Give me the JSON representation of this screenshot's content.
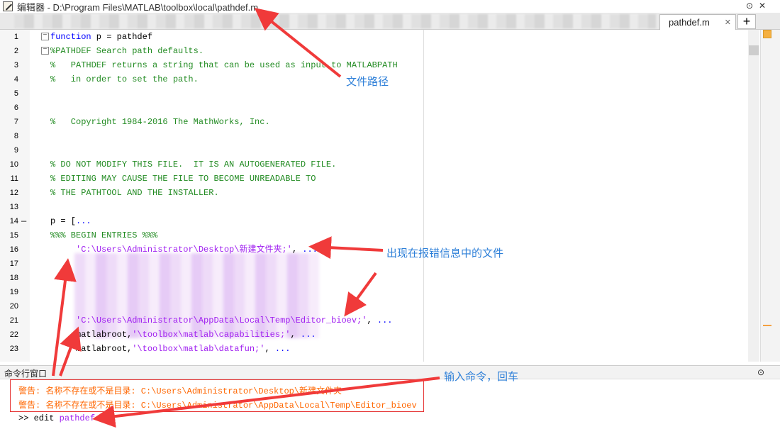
{
  "window": {
    "title": "编辑器 - D:\\Program Files\\MATLAB\\toolbox\\local\\pathdef.m"
  },
  "tabs": {
    "active": "pathdef.m",
    "close": "✕",
    "add": "+"
  },
  "editor": {
    "lines": [
      {
        "n": "1",
        "parts": [
          [
            "k",
            "function"
          ],
          [
            "n",
            " p = pathdef"
          ]
        ]
      },
      {
        "n": "2",
        "parts": [
          [
            "c",
            "%PATHDEF Search path defaults."
          ]
        ]
      },
      {
        "n": "3",
        "parts": [
          [
            "c",
            "%   PATHDEF returns a string that can be used as input to MATLABPATH"
          ]
        ]
      },
      {
        "n": "4",
        "parts": [
          [
            "c",
            "%   in order to set the path."
          ]
        ]
      },
      {
        "n": "5",
        "parts": []
      },
      {
        "n": "6",
        "parts": []
      },
      {
        "n": "7",
        "parts": [
          [
            "c",
            "%   Copyright 1984-2016 The MathWorks, Inc."
          ]
        ]
      },
      {
        "n": "8",
        "parts": []
      },
      {
        "n": "9",
        "parts": []
      },
      {
        "n": "10",
        "parts": [
          [
            "c",
            "% DO NOT MODIFY THIS FILE.  IT IS AN AUTOGENERATED FILE."
          ]
        ]
      },
      {
        "n": "11",
        "parts": [
          [
            "c",
            "% EDITING MAY CAUSE THE FILE TO BECOME UNREADABLE TO"
          ]
        ]
      },
      {
        "n": "12",
        "parts": [
          [
            "c",
            "% THE PATHTOOL AND THE INSTALLER."
          ]
        ]
      },
      {
        "n": "13",
        "parts": []
      },
      {
        "n": "14",
        "parts": [
          [
            "n",
            "p = ["
          ],
          [
            "k",
            "..."
          ]
        ]
      },
      {
        "n": "15",
        "parts": [
          [
            "c",
            "%%% BEGIN ENTRIES %%%"
          ]
        ]
      },
      {
        "n": "16",
        "parts": [
          [
            "n",
            "     "
          ],
          [
            "s",
            "'C:\\Users\\Administrator\\Desktop\\新建文件夹;'"
          ],
          [
            "n",
            ", "
          ],
          [
            "k",
            "..."
          ]
        ]
      },
      {
        "n": "17",
        "parts": []
      },
      {
        "n": "18",
        "parts": []
      },
      {
        "n": "19",
        "parts": []
      },
      {
        "n": "20",
        "parts": []
      },
      {
        "n": "21",
        "parts": [
          [
            "n",
            "     "
          ],
          [
            "s",
            "'C:\\Users\\Administrator\\AppData\\Local\\Temp\\Editor_bioev;'"
          ],
          [
            "n",
            ", "
          ],
          [
            "k",
            "..."
          ]
        ]
      },
      {
        "n": "22",
        "parts": [
          [
            "n",
            "     matlabroot,"
          ],
          [
            "s",
            "'\\toolbox\\matlab\\capabilities;'"
          ],
          [
            "n",
            ", "
          ],
          [
            "k",
            "..."
          ]
        ]
      },
      {
        "n": "23",
        "parts": [
          [
            "n",
            "     matlabroot,"
          ],
          [
            "s",
            "'\\toolbox\\matlab\\datafun;'"
          ],
          [
            "n",
            ", "
          ],
          [
            "k",
            "..."
          ]
        ]
      }
    ]
  },
  "command_window": {
    "title": "命令行窗口",
    "warnings": [
      "警告: 名称不存在或不是目录: C:\\Users\\Administrator\\Desktop\\新建文件夹",
      "警告: 名称不存在或不是目录: C:\\Users\\Administrator\\AppData\\Local\\Temp\\Editor_bioev"
    ],
    "prompt": ">>",
    "command": "edit",
    "argument": "pathdef"
  },
  "annotations": {
    "file_path": "文件路径",
    "error_files": "出现在报错信息中的文件",
    "enter_command": "输入命令，回车"
  },
  "colors": {
    "keyword": "#0000ff",
    "comment": "#228b22",
    "string": "#a020f0",
    "warning": "#ff6600",
    "annotation": "#2d7fd8",
    "arrow": "#f03a3a"
  }
}
